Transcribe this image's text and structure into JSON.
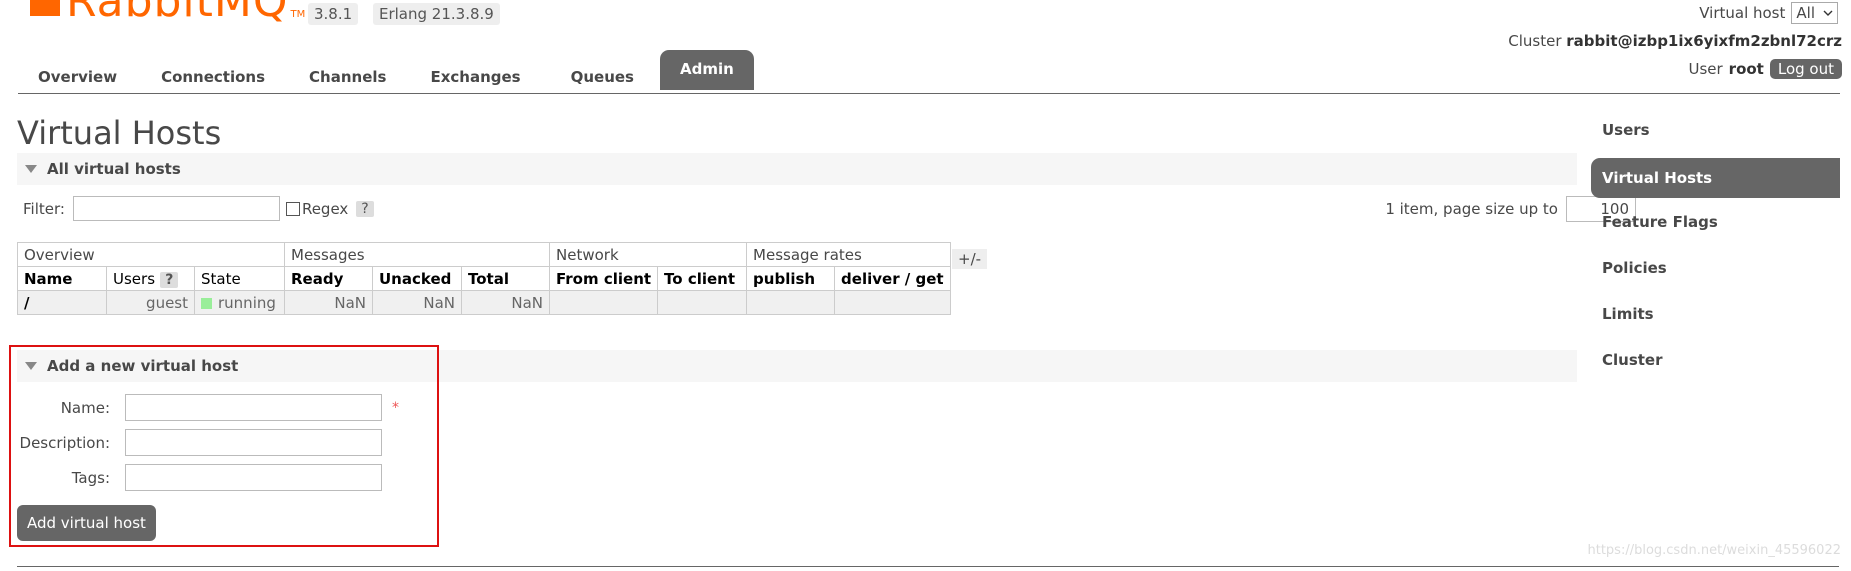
{
  "header": {
    "logo_text": "RabbitMQ",
    "logo_tm": "TM",
    "version": "3.8.1",
    "erlang": "Erlang 21.3.8.9",
    "virtual_host_label": "Virtual host",
    "virtual_host_value": "All",
    "cluster_label": "Cluster",
    "cluster_value": "rabbit@izbp1ix6yixfm2zbnl72crz",
    "user_label": "User",
    "user_value": "root",
    "logout_label": "Log out"
  },
  "tabs": [
    "Overview",
    "Connections",
    "Channels",
    "Exchanges",
    "Queues",
    "Admin"
  ],
  "active_tab": "Admin",
  "page_title": "Virtual Hosts",
  "all_section": {
    "title": "All virtual hosts",
    "filter_label": "Filter:",
    "regex_label": "Regex",
    "help_glyph": "?",
    "paging_text": "1 item, page size up to",
    "page_size": "100",
    "columns_toggle": "+/-"
  },
  "table": {
    "groups": [
      "Overview",
      "Messages",
      "Network",
      "Message rates"
    ],
    "headers": [
      "Name",
      "Users",
      "State",
      "Ready",
      "Unacked",
      "Total",
      "From client",
      "To client",
      "publish",
      "deliver / get"
    ],
    "rows": [
      {
        "name": "/",
        "users": "guest",
        "state": "running",
        "ready": "NaN",
        "unacked": "NaN",
        "total": "NaN",
        "from_client": "",
        "to_client": "",
        "publish": "",
        "deliver_get": ""
      }
    ]
  },
  "add_section": {
    "title": "Add a new virtual host",
    "name_label": "Name:",
    "description_label": "Description:",
    "tags_label": "Tags:",
    "required_mark": "*",
    "submit_label": "Add virtual host"
  },
  "sidebar": {
    "items": [
      "Users",
      "Virtual Hosts",
      "Feature Flags",
      "Policies",
      "Limits",
      "Cluster"
    ],
    "active": "Virtual Hosts"
  },
  "watermark": "https://blog.csdn.net/weixin_45596022",
  "colors": {
    "brand": "#ff6600",
    "tab_active_bg": "#666666",
    "highlight_border": "#dd1111",
    "running_dot": "#99ee99"
  }
}
